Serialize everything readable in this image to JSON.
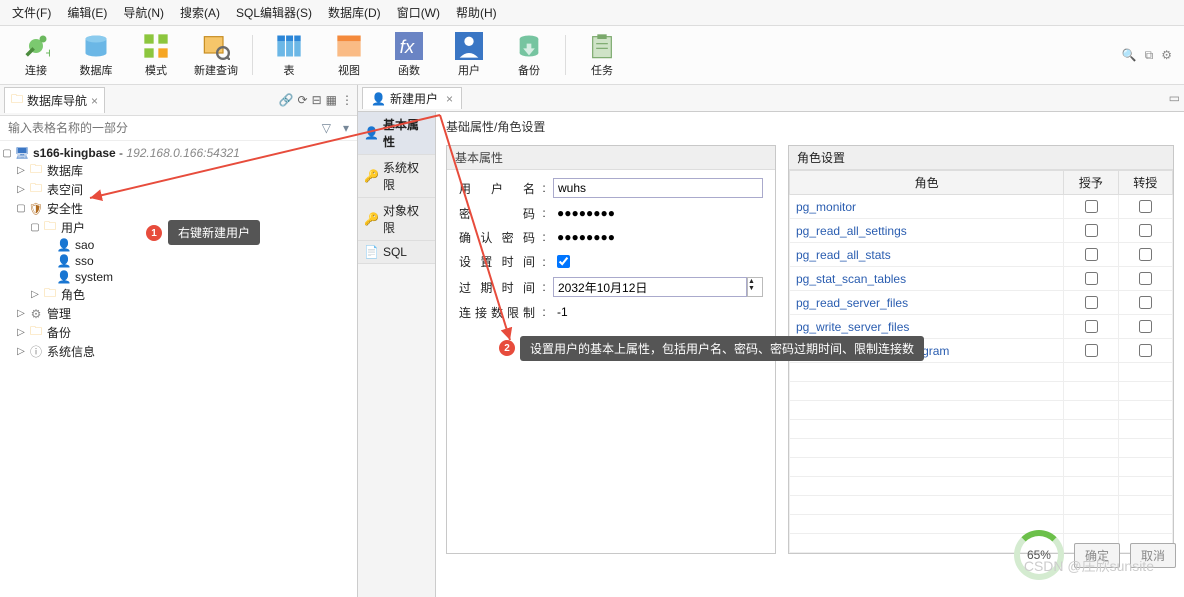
{
  "menu": [
    "文件(F)",
    "编辑(E)",
    "导航(N)",
    "搜索(A)",
    "SQL编辑器(S)",
    "数据库(D)",
    "窗口(W)",
    "帮助(H)"
  ],
  "tools": [
    {
      "label": "连接",
      "icon": "plug"
    },
    {
      "label": "数据库",
      "icon": "db"
    },
    {
      "label": "模式",
      "icon": "grid"
    },
    {
      "label": "新建查询",
      "icon": "sql"
    },
    {
      "label": "表",
      "icon": "table"
    },
    {
      "label": "视图",
      "icon": "view"
    },
    {
      "label": "函数",
      "icon": "fx"
    },
    {
      "label": "用户",
      "icon": "user"
    },
    {
      "label": "备份",
      "icon": "backup"
    },
    {
      "label": "任务",
      "icon": "task"
    }
  ],
  "navigator": {
    "title": "数据库导航",
    "filter_placeholder": "输入表格名称的一部分",
    "tree": {
      "root": {
        "name": "s166-kingbase",
        "addr": "192.168.0.166:54321"
      },
      "children": [
        "数据库",
        "表空间",
        "安全性",
        "管理",
        "备份",
        "系统信息"
      ],
      "security_children": {
        "users": "用户",
        "roles": "角色"
      },
      "user_list": [
        "sao",
        "sso",
        "system"
      ]
    }
  },
  "callouts": {
    "c1": "右键新建用户",
    "c2": "设置用户的基本上属性，包括用户名、密码、密码过期时间、限制连接数"
  },
  "editor": {
    "tab": "新建用户",
    "vtabs": [
      "基本属性",
      "系统权限",
      "对象权限",
      "SQL"
    ],
    "heading": "基础属性/角色设置",
    "basic_panel": "基本属性",
    "fields": {
      "username_lbl": "用 户 名",
      "username_val": "wuhs",
      "password_lbl": "密    码",
      "password_val": "●●●●●●●●",
      "confirm_lbl": "确认密码",
      "confirm_val": "●●●●●●●●",
      "settime_lbl": "设置时间",
      "expire_lbl": "过期时间",
      "expire_val": "2032年10月12日",
      "connlimit_lbl": "连接数限制",
      "connlimit_val": "-1"
    },
    "roles_panel": "角色设置",
    "roles_cols": [
      "角色",
      "授予",
      "转授"
    ],
    "roles_rows": [
      "pg_monitor",
      "pg_read_all_settings",
      "pg_read_all_stats",
      "pg_stat_scan_tables",
      "pg_read_server_files",
      "pg_write_server_files",
      "pg_execute_server_program"
    ]
  },
  "footer": {
    "pct": "65%",
    "ok": "确定",
    "cancel": "取消"
  },
  "watermark": "CSDN @庄欣sunsite"
}
